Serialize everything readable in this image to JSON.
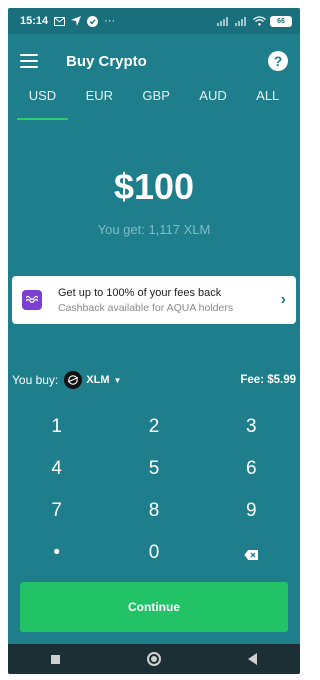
{
  "status_bar": {
    "time": "15:14",
    "more": "···",
    "battery": "66"
  },
  "app_bar": {
    "title": "Buy Crypto",
    "help_label": "?"
  },
  "tabs": [
    {
      "label": "USD",
      "active": true
    },
    {
      "label": "EUR",
      "active": false
    },
    {
      "label": "GBP",
      "active": false
    },
    {
      "label": "AUD",
      "active": false
    },
    {
      "label": "ALL",
      "active": false
    }
  ],
  "amount": "$100",
  "receive_text": "You get: 1,117 XLM",
  "promo": {
    "title": "Get up to 100% of your fees back",
    "subtitle": "Cashback available for AQUA holders",
    "chevron": "›"
  },
  "buy_row": {
    "label": "You buy:",
    "coin": "XLM",
    "fee": "Fee: $5.99"
  },
  "keypad": [
    [
      "1",
      "2",
      "3"
    ],
    [
      "4",
      "5",
      "6"
    ],
    [
      "7",
      "8",
      "9"
    ],
    [
      "•",
      "0",
      ""
    ]
  ],
  "continue_label": "Continue",
  "colors": {
    "background": "#1f7e8c",
    "accent": "#22c266",
    "promo_icon": "#7b3fd1"
  }
}
